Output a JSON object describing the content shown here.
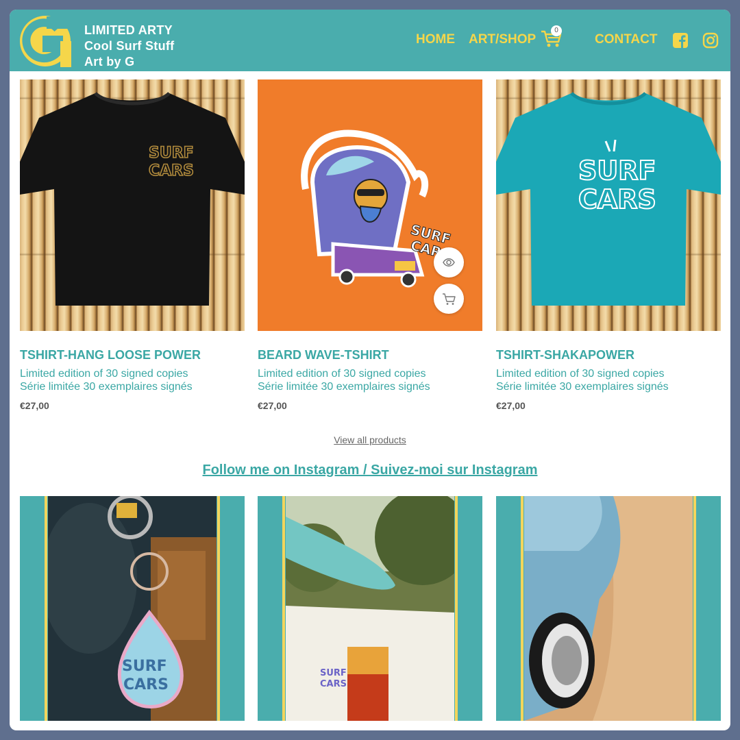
{
  "brand": {
    "line1": "LIMITED ARTY",
    "line2": "Cool Surf Stuff",
    "line3": "Art by G",
    "logo_letter": "G"
  },
  "nav": {
    "home": "HOME",
    "artshop": "ART/SHOP",
    "cart_count": "0",
    "contact": "CONTACT"
  },
  "colors": {
    "header": "#4aadad",
    "nav_text": "#f5d64a",
    "product_text": "#3aa7a4"
  },
  "products": [
    {
      "title": "TSHIRT-HANG LOOSE POWER",
      "desc_en": "Limited edition of 30 signed copies",
      "desc_fr": "Série limitée 30 exemplaires signés",
      "price": "€27,00"
    },
    {
      "title": "BEARD WAVE-TSHIRT",
      "desc_en": "Limited edition of 30 signed copies",
      "desc_fr": "Série limitée 30 exemplaires signés",
      "price": "€27,00"
    },
    {
      "title": "TSHIRT-SHAKAPOWER",
      "desc_en": "Limited edition of 30 signed copies",
      "desc_fr": "Série limitée 30 exemplaires signés",
      "price": "€27,00"
    }
  ],
  "view_all": "View all products",
  "instagram_title": "Follow me on Instagram / Suivez-moi sur Instagram",
  "print_text": {
    "surf": "SURF",
    "cars": "CARS"
  },
  "icons": [
    "shopping-cart-icon",
    "facebook-icon",
    "instagram-icon",
    "eye-icon",
    "add-to-cart-icon"
  ]
}
